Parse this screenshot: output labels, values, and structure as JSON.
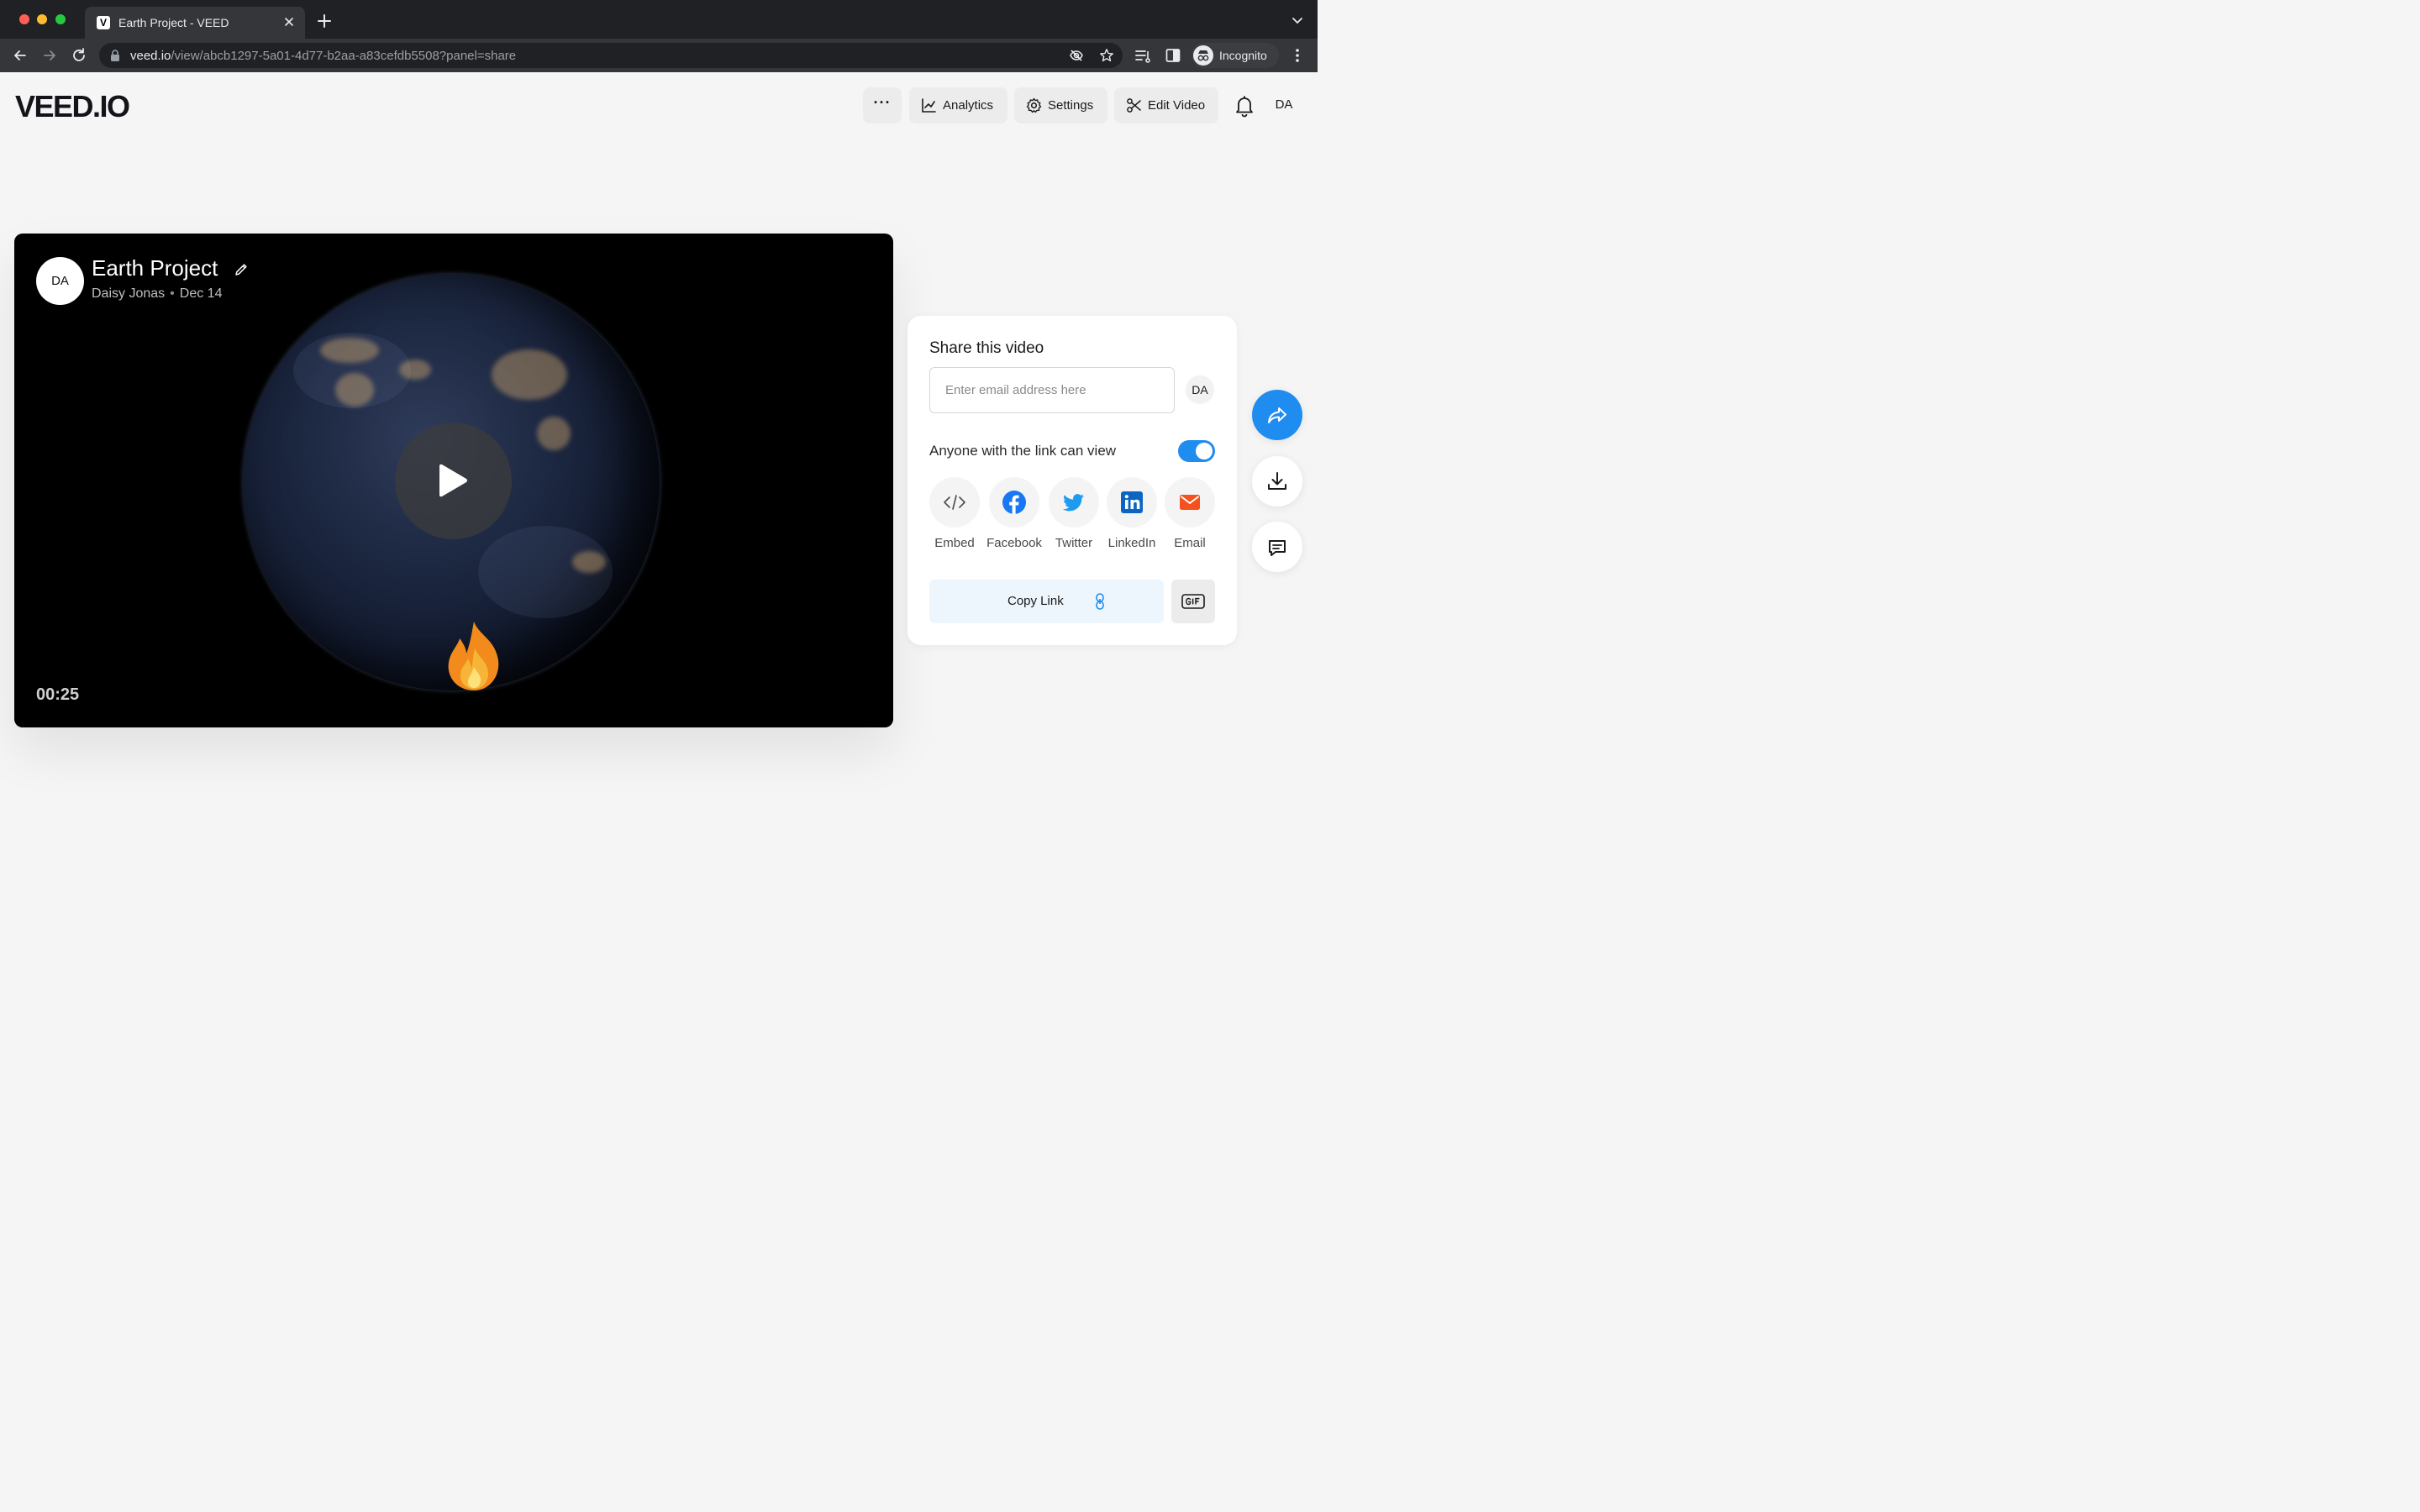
{
  "browser": {
    "tab_title": "Earth Project - VEED",
    "tab_favicon": "V",
    "url_host": "veed.io",
    "url_path": "/view/abcb1297-5a01-4d77-b2aa-a83cefdb5508?panel=share",
    "profile_label": "Incognito",
    "icons": [
      "back-icon",
      "forward-icon",
      "reload-icon",
      "lock-icon",
      "eye-off-icon",
      "star-icon",
      "reading-list-icon",
      "side-panel-icon",
      "incognito-icon",
      "more-vert-icon",
      "tab-menu-icon",
      "close-icon",
      "plus-icon"
    ]
  },
  "header": {
    "logo": "VEED.IO",
    "more_label": "···",
    "analytics_label": "Analytics",
    "settings_label": "Settings",
    "edit_label": "Edit Video",
    "avatar_initials": "DA"
  },
  "video": {
    "title": "Earth Project",
    "author": "Daisy Jonas",
    "separator": "•",
    "date": "Dec 14",
    "avatar_initials": "DA",
    "timestamp": "00:25",
    "reaction_icon": "fire-icon"
  },
  "share_panel": {
    "title": "Share this video",
    "email_placeholder": "Enter email address here",
    "email_value": "",
    "avatar_initials": "DA",
    "link_permission_label": "Anyone with the link can view",
    "link_permission_enabled": true,
    "targets": [
      {
        "label": "Embed",
        "icon": "code-icon"
      },
      {
        "label": "Facebook",
        "icon": "facebook-icon"
      },
      {
        "label": "Twitter",
        "icon": "twitter-icon"
      },
      {
        "label": "LinkedIn",
        "icon": "linkedin-icon"
      },
      {
        "label": "Email",
        "icon": "mail-icon"
      }
    ],
    "copy_link_label": "Copy Link",
    "gif_icon": "gif-icon"
  },
  "colors": {
    "accent_blue": "#1f8cf0",
    "facebook": "#1877f2",
    "twitter": "#1d9bf0",
    "linkedin": "#0a66c2",
    "email": "#f4511e",
    "copy_link_bg": "#edf6fd"
  }
}
